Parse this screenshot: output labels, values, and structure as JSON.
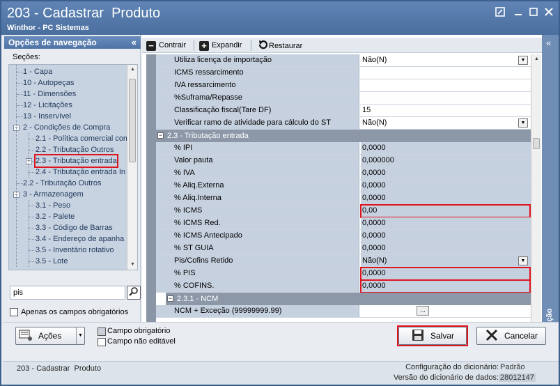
{
  "window": {
    "title": "203 - Cadastrar  Produto",
    "subtitle": "Winthor - PC Sistemas",
    "controls": [
      "restore-icon",
      "minimize-icon",
      "maximize-icon",
      "close-icon"
    ]
  },
  "nav": {
    "header": "Opções de navegação",
    "collapse": "«",
    "sections_label": "Seções:",
    "tree": [
      {
        "label": "1 - Capa",
        "level": 1
      },
      {
        "label": "10 - Autopeças",
        "level": 1
      },
      {
        "label": "11 - Dimensões",
        "level": 1
      },
      {
        "label": "12 - Licitações",
        "level": 1
      },
      {
        "label": "13 - Inservível",
        "level": 1
      },
      {
        "label": "2 - Condições de Compra",
        "level": 0,
        "expander": "−"
      },
      {
        "label": "2.1 - Política comercial comp",
        "level": 2
      },
      {
        "label": "2.2 - Tributação Outros",
        "level": 2
      },
      {
        "label": "2.3 - Tributação entrada",
        "level": 2,
        "expander": "+",
        "highlighted": true
      },
      {
        "label": "2.4 - Tributação entrada In",
        "level": 2
      },
      {
        "label": "2.2 - Tributação Outros",
        "level": 1
      },
      {
        "label": "3 - Armazenagem",
        "level": 0,
        "expander": "−"
      },
      {
        "label": "3.1 - Peso",
        "level": 2
      },
      {
        "label": "3.2 - Palete",
        "level": 2
      },
      {
        "label": "3.3 - Código de Barras",
        "level": 2
      },
      {
        "label": "3.4 - Endereço de apanha",
        "level": 2
      },
      {
        "label": "3.5 - Inventário rotativo",
        "level": 2
      },
      {
        "label": "3.5 - Lote",
        "level": 2
      }
    ],
    "search_value": "pis",
    "required_only_label": "Apenas os campos obrigatórios"
  },
  "toolbar": {
    "collapse_label": "Contrair",
    "expand_label": "Expandir",
    "restore_label": "Restaurar"
  },
  "grid": {
    "rows_top": [
      {
        "name": "Utiliza licença de importação",
        "value": "Não(N)",
        "dropdown": true
      },
      {
        "name": "ICMS ressarcimento",
        "value": ""
      },
      {
        "name": "IVA ressarcimento",
        "value": ""
      },
      {
        "name": "%Suframa/Repasse",
        "value": ""
      },
      {
        "name": "Classificação fiscal(Tare DF)",
        "value": "15"
      },
      {
        "name": "Verificar ramo de atividade para cálculo do ST",
        "value": "Não(N)",
        "dropdown": true
      }
    ],
    "group_entrada": "2.3 - Tributação entrada",
    "rows_entrada": [
      {
        "name": "% IPI",
        "value": "0,0000"
      },
      {
        "name": "Valor pauta",
        "value": "0,000000"
      },
      {
        "name": "% IVA",
        "value": "0,0000"
      },
      {
        "name": "% Aliq.Externa",
        "value": "0,0000"
      },
      {
        "name": "% Aliq.Interna",
        "value": "0,0000"
      },
      {
        "name": "% ICMS",
        "value": "0,00",
        "highlighted": true
      },
      {
        "name": "% ICMS Red.",
        "value": "0,0000"
      },
      {
        "name": "% ICMS Antecipado",
        "value": "0,0000"
      },
      {
        "name": "% ST GUIA",
        "value": "0,0000"
      },
      {
        "name": "Pis/Cofins Retido",
        "value": "Não(N)",
        "dropdown": true
      },
      {
        "name": "% PIS",
        "value": "0,0000",
        "highlighted": true
      },
      {
        "name": "% COFINS.",
        "value": "0,0000",
        "highlighted": true
      }
    ],
    "group_ncm": "2.3.1 - NCM",
    "row_ncm": {
      "name": "NCM + Exceção (99999999.99)",
      "value": "",
      "ellipsis": "..."
    }
  },
  "info_panel": {
    "label": "Informação",
    "collapse": "«"
  },
  "footer": {
    "actions_label": "Ações",
    "required_field_label": "Campo obrigatório",
    "non_editable_label": "Campo não editável",
    "save_label": "Salvar",
    "cancel_label": "Cancelar"
  },
  "statusbar": {
    "title": "203 - Cadastrar  Produto",
    "dict_config_label": "Configuração do dicionário:",
    "dict_config_value": "Padrão",
    "dict_version_label": "Versão do dicionário de dados:",
    "dict_version_value": "28012147"
  },
  "colors": {
    "title_bar": "#5478a9",
    "highlight": "#e0141e",
    "grid_label_bg": "#c6d1df",
    "group_bg": "#8c98a8"
  }
}
